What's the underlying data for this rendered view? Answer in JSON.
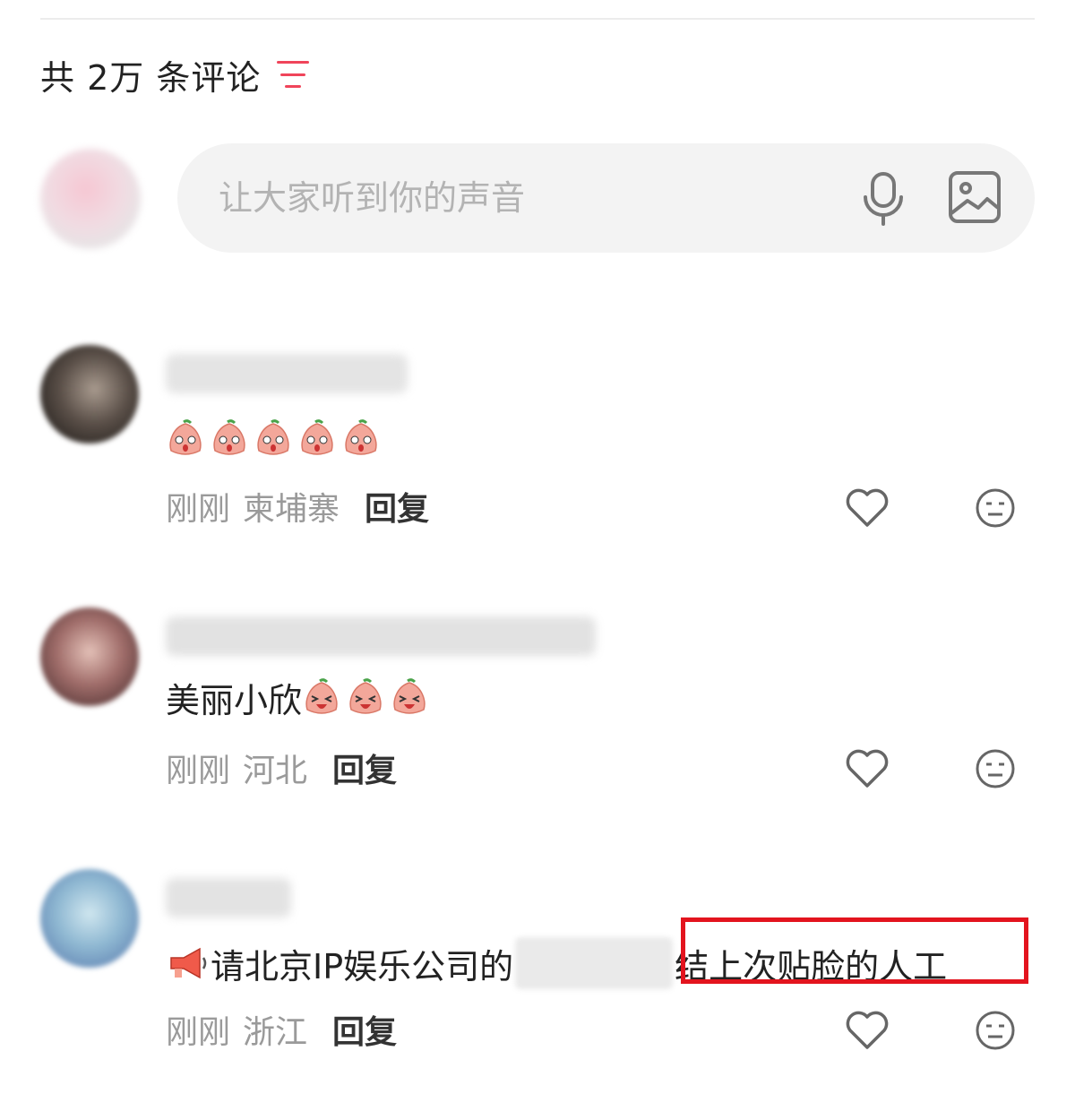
{
  "header": {
    "title": "共 2万 条评论",
    "sort_color": "#f0445a"
  },
  "composer": {
    "placeholder": "让大家听到你的声音",
    "mic_icon": "mic-icon",
    "image_icon": "image-icon"
  },
  "comments": [
    {
      "text": "",
      "emojis": [
        "peach-surprised-emoji",
        "peach-surprised-emoji",
        "peach-surprised-emoji",
        "peach-surprised-emoji",
        "peach-surprised-emoji"
      ],
      "time": "刚刚",
      "location": "柬埔寨",
      "reply_label": "回复"
    },
    {
      "text": "美丽小欣",
      "emojis": [
        "peach-laughing-emoji",
        "peach-laughing-emoji",
        "peach-laughing-emoji"
      ],
      "time": "刚刚",
      "location": "河北",
      "reply_label": "回复"
    },
    {
      "text_prefix": "请北京IP娱乐公司的",
      "text_suffix": "结上次贴脸的人工",
      "time": "刚刚",
      "location": "浙江",
      "reply_label": "回复",
      "highlight_color": "#e3141e"
    }
  ],
  "icons": {
    "like": "heart-outline-icon",
    "react": "neutral-face-icon"
  }
}
